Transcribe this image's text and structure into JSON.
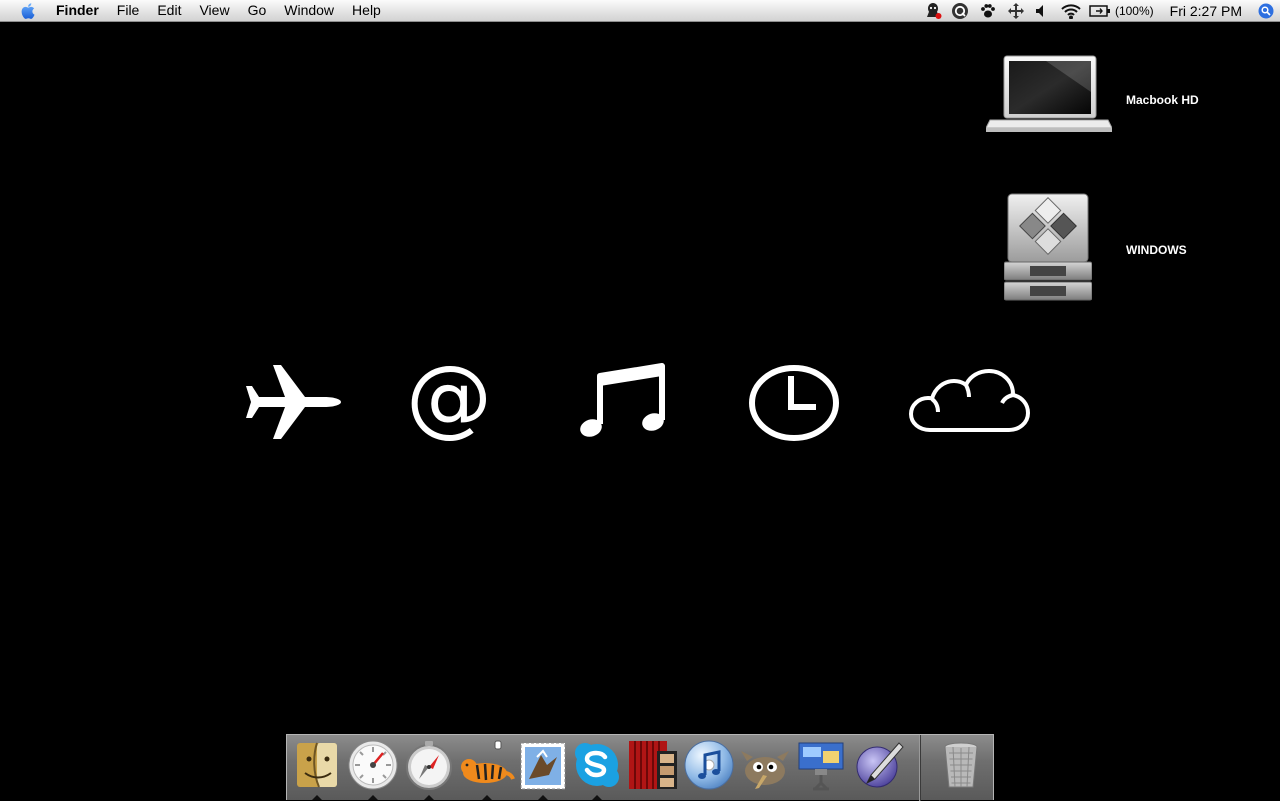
{
  "menubar": {
    "app_name": "Finder",
    "items": [
      "File",
      "Edit",
      "View",
      "Go",
      "Window",
      "Help"
    ],
    "battery_percent": "(100%)",
    "clock": "Fri 2:27 PM"
  },
  "desktop": {
    "disks": [
      {
        "label": "Macbook HD",
        "icon": "laptop-icon"
      },
      {
        "label": "WINDOWS",
        "icon": "windows-drive-icon"
      }
    ],
    "wallpaper_glyphs": [
      "airplane-icon",
      "at-sign-icon",
      "music-note-icon",
      "clock-icon",
      "cloud-icon"
    ],
    "at_glyph": "@"
  },
  "dock": {
    "apps": [
      {
        "name": "Finder",
        "icon": "finder-icon",
        "running": true
      },
      {
        "name": "Dashboard",
        "icon": "dashboard-icon",
        "running": true
      },
      {
        "name": "Safari",
        "icon": "safari-icon",
        "running": true
      },
      {
        "name": "Adium",
        "icon": "tiger-icon",
        "running": true
      },
      {
        "name": "Mail",
        "icon": "mail-stamp-icon",
        "running": true
      },
      {
        "name": "Skype",
        "icon": "skype-icon",
        "running": true
      },
      {
        "name": "Photo Booth",
        "icon": "photo-booth-icon",
        "running": false
      },
      {
        "name": "iTunes",
        "icon": "itunes-icon",
        "running": false
      },
      {
        "name": "GIMP",
        "icon": "gimp-icon",
        "running": false
      },
      {
        "name": "Keynote",
        "icon": "keynote-icon",
        "running": false
      },
      {
        "name": "Script Editor",
        "icon": "pen-icon",
        "running": false
      },
      {
        "name": "Trash",
        "icon": "trash-icon",
        "running": false
      }
    ]
  },
  "colors": {
    "desktop": "#000000",
    "dock": "#6f6f6f",
    "skype": "#1ba1e2"
  }
}
